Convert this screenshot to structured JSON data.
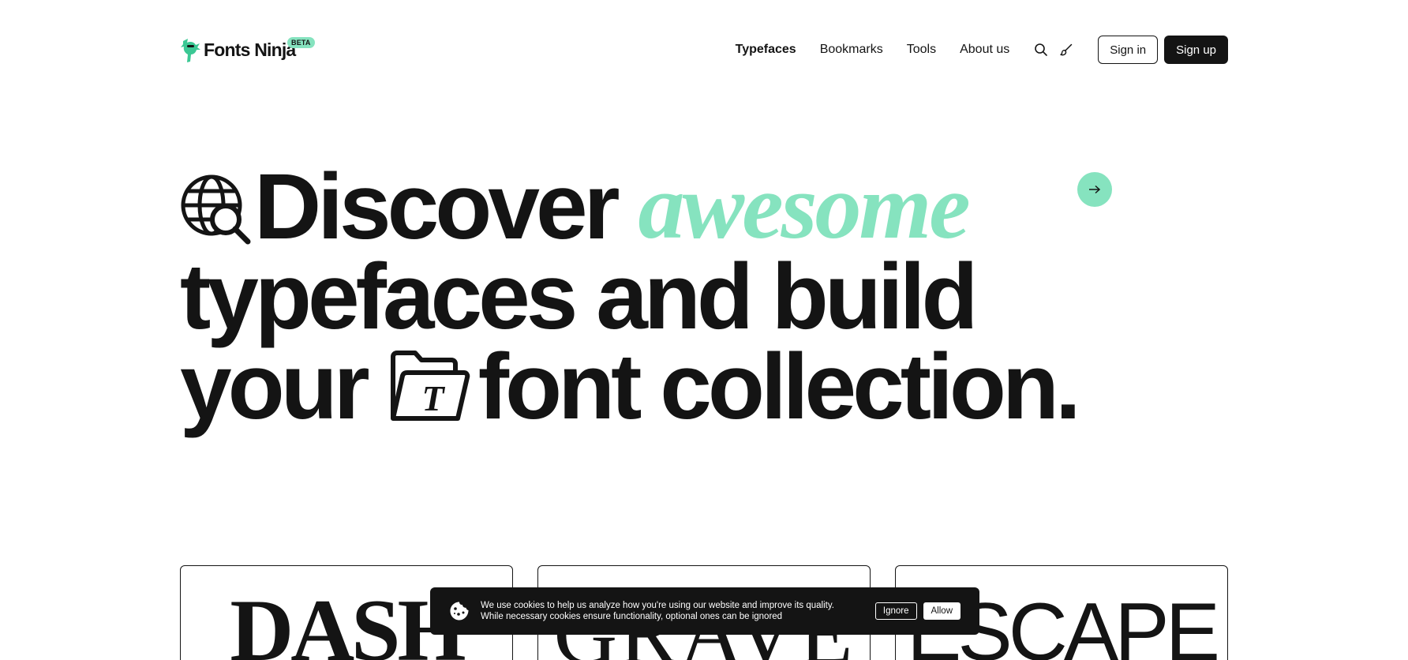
{
  "brand": {
    "name": "Fonts Ninja",
    "badge": "BETA",
    "accent_color": "#86e3bf",
    "ink_color": "#141414"
  },
  "nav": {
    "links": [
      {
        "label": "Typefaces",
        "active": true
      },
      {
        "label": "Bookmarks",
        "active": false
      },
      {
        "label": "Tools",
        "active": false
      },
      {
        "label": "About us",
        "active": false
      }
    ],
    "icons": [
      "search-icon",
      "brush-icon"
    ],
    "sign_in": "Sign in",
    "sign_up": "Sign up"
  },
  "hero": {
    "line1_word": "Discover",
    "line1_accent": "awesome",
    "line2": "typefaces and build",
    "line3_start": "your",
    "line3_end": "font collection.",
    "icons": [
      "globe-search-icon",
      "font-folder-icon",
      "arrow-right-icon"
    ]
  },
  "cards": [
    {
      "specimen": "DASH"
    },
    {
      "specimen": "GRAVE"
    },
    {
      "specimen": "ESCAPE"
    }
  ],
  "cookie_banner": {
    "text_line1": "We use cookies to help us analyze how you're using our website and improve its quality.",
    "text_line2": "While necessary cookies ensure functionality, optional ones can be ignored",
    "ignore": "Ignore",
    "allow": "Allow"
  }
}
